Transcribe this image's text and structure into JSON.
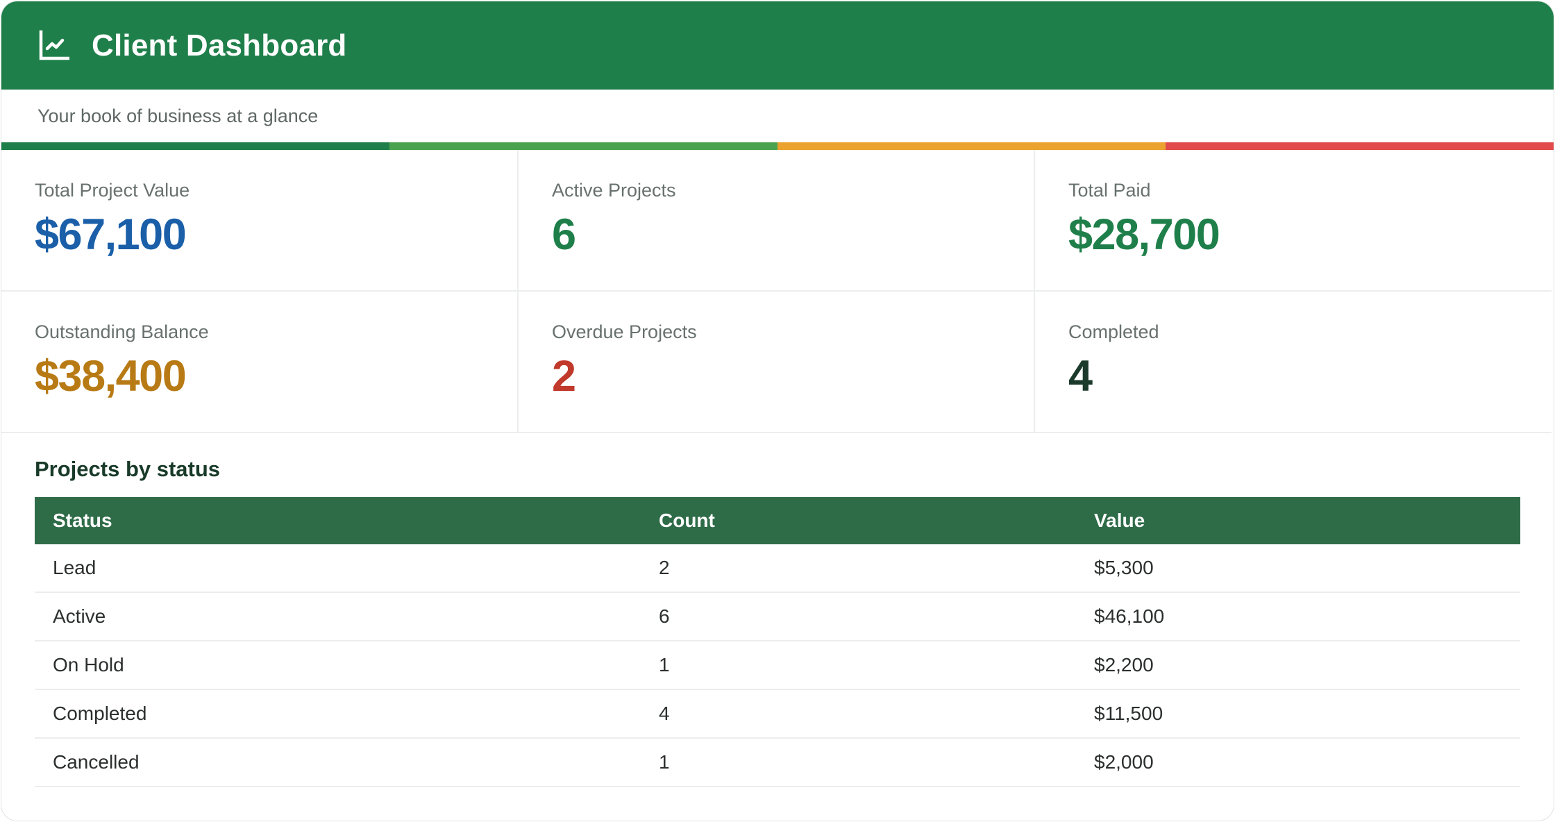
{
  "header": {
    "title": "Client Dashboard",
    "icon": "line-chart-icon",
    "background": "#1f7f4a"
  },
  "subtitle": "Your book of business at a glance",
  "stripe_colors": [
    "#1f7f4a",
    "#4ba34f",
    "#eba22f",
    "#e24b4b"
  ],
  "stats": [
    {
      "label": "Total Project Value",
      "value": "$67,100",
      "color": "#1a5fa8"
    },
    {
      "label": "Active Projects",
      "value": "6",
      "color": "#1f7f4a"
    },
    {
      "label": "Total Paid",
      "value": "$28,700",
      "color": "#1f7f4a"
    },
    {
      "label": "Outstanding Balance",
      "value": "$38,400",
      "color": "#b87a14"
    },
    {
      "label": "Overdue Projects",
      "value": "2",
      "color": "#c0392b"
    },
    {
      "label": "Completed",
      "value": "4",
      "color": "#1b3a2b"
    }
  ],
  "projects": {
    "title": "Projects by status",
    "columns": [
      "Status",
      "Count",
      "Value"
    ],
    "rows": [
      [
        "Lead",
        "2",
        "$5,300"
      ],
      [
        "Active",
        "6",
        "$46,100"
      ],
      [
        "On Hold",
        "1",
        "$2,200"
      ],
      [
        "Completed",
        "4",
        "$11,500"
      ],
      [
        "Cancelled",
        "1",
        "$2,000"
      ]
    ]
  }
}
